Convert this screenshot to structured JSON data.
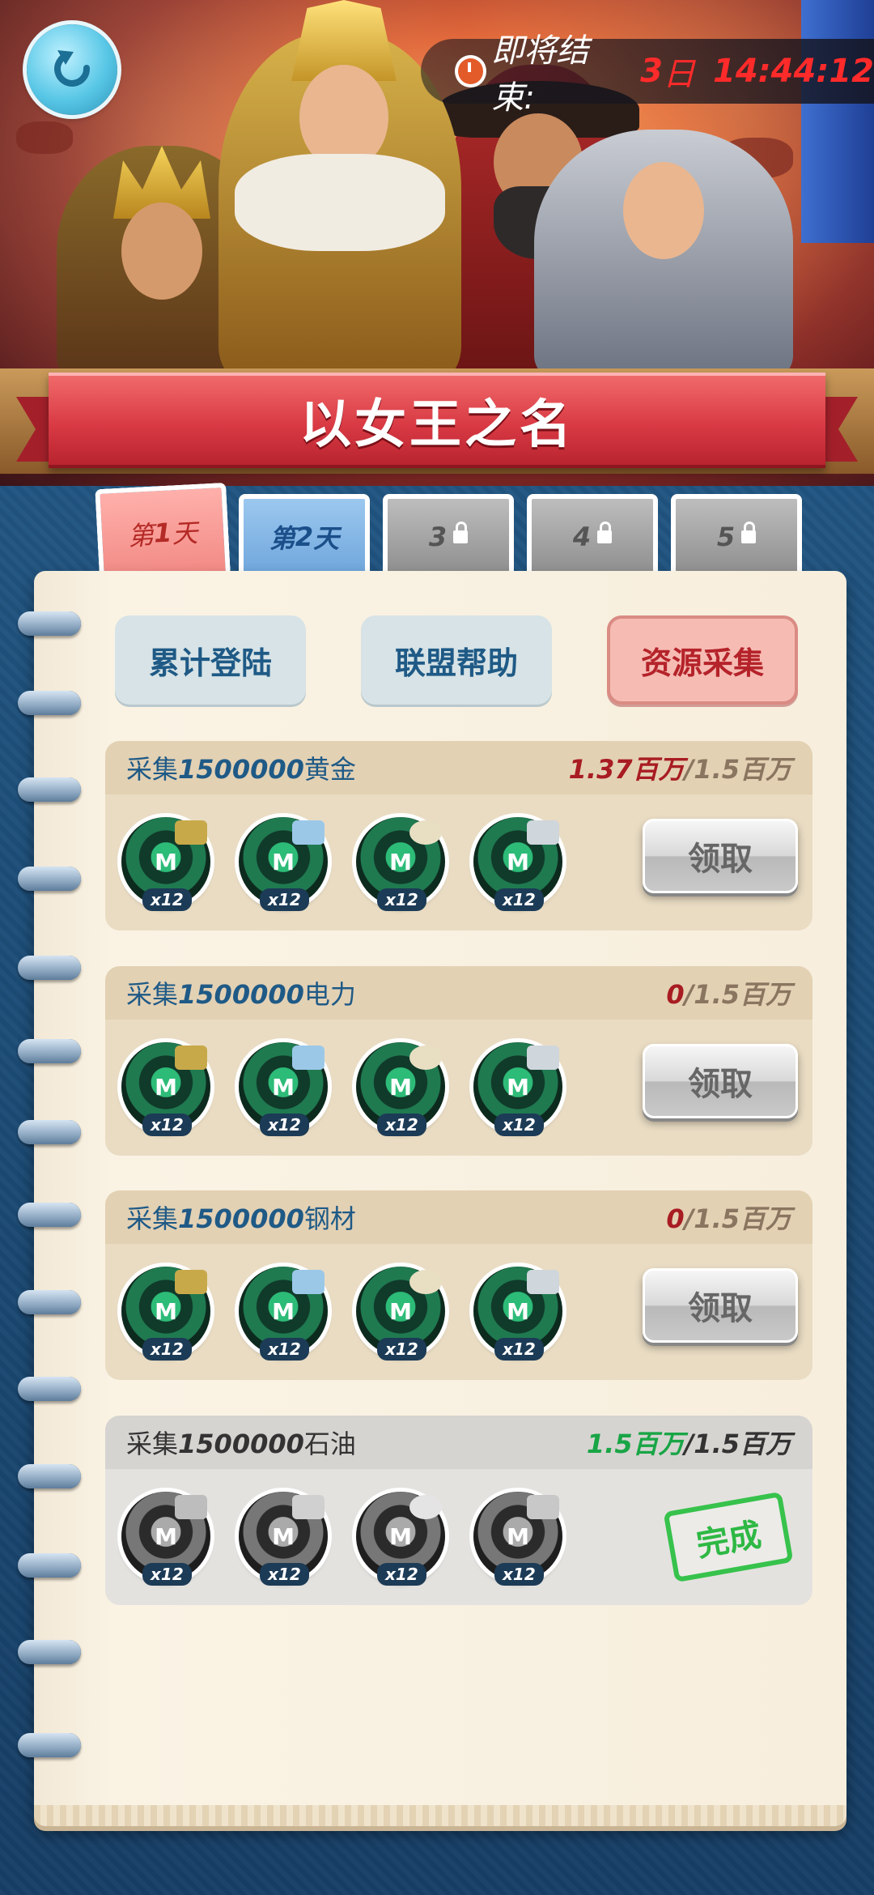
{
  "event": {
    "title": "以女王之名",
    "countdown_label": "即将结束:",
    "countdown_days": "3",
    "countdown_days_unit": "日",
    "countdown_time": "14:44:12"
  },
  "day_tabs": [
    {
      "prefix": "第",
      "num": "1",
      "suffix": "天",
      "state": "active"
    },
    {
      "prefix": "第",
      "num": "2",
      "suffix": "天",
      "state": "unlocked"
    },
    {
      "num": "3",
      "state": "locked"
    },
    {
      "num": "4",
      "state": "locked"
    },
    {
      "num": "5",
      "state": "locked"
    }
  ],
  "categories": [
    {
      "label": "累计登陆",
      "active": false
    },
    {
      "label": "联盟帮助",
      "active": false
    },
    {
      "label": "资源采集",
      "active": true
    }
  ],
  "tasks": [
    {
      "prefix": "采集",
      "amount": "1500000",
      "resource": "黄金",
      "current": "1.37百万",
      "sep": "/",
      "target": "1.5百万",
      "rewards": [
        {
          "icon": "tank-token-icon",
          "qty": "x12"
        },
        {
          "icon": "ship-token-icon",
          "qty": "x12"
        },
        {
          "icon": "cannonball-token-icon",
          "qty": "x12"
        },
        {
          "icon": "wrench-token-icon",
          "qty": "x12"
        }
      ],
      "button": "领取",
      "completed": false
    },
    {
      "prefix": "采集",
      "amount": "1500000",
      "resource": "电力",
      "current": "0",
      "sep": "/",
      "target": "1.5百万",
      "rewards": [
        {
          "icon": "tank-token-icon",
          "qty": "x12"
        },
        {
          "icon": "ship-token-icon",
          "qty": "x12"
        },
        {
          "icon": "cannonball-token-icon",
          "qty": "x12"
        },
        {
          "icon": "wrench-token-icon",
          "qty": "x12"
        }
      ],
      "button": "领取",
      "completed": false
    },
    {
      "prefix": "采集",
      "amount": "1500000",
      "resource": "钢材",
      "current": "0",
      "sep": "/",
      "target": "1.5百万",
      "rewards": [
        {
          "icon": "tank-token-icon",
          "qty": "x12"
        },
        {
          "icon": "ship-token-icon",
          "qty": "x12"
        },
        {
          "icon": "cannonball-token-icon",
          "qty": "x12"
        },
        {
          "icon": "wrench-token-icon",
          "qty": "x12"
        }
      ],
      "button": "领取",
      "completed": false
    },
    {
      "prefix": "采集",
      "amount": "1500000",
      "resource": "石油",
      "current": "1.5百万",
      "sep": "/",
      "target": "1.5百万",
      "rewards": [
        {
          "icon": "tank-token-icon",
          "qty": "x12"
        },
        {
          "icon": "ship-token-icon",
          "qty": "x12"
        },
        {
          "icon": "cannonball-token-icon",
          "qty": "x12"
        },
        {
          "icon": "wrench-token-icon",
          "qty": "x12"
        }
      ],
      "stamp": "完成",
      "completed": true
    }
  ],
  "colors": {
    "accent_red": "#d93a44",
    "progress_red": "#a81c22",
    "complete_green": "#19a546",
    "text_blue": "#1f5a86"
  }
}
